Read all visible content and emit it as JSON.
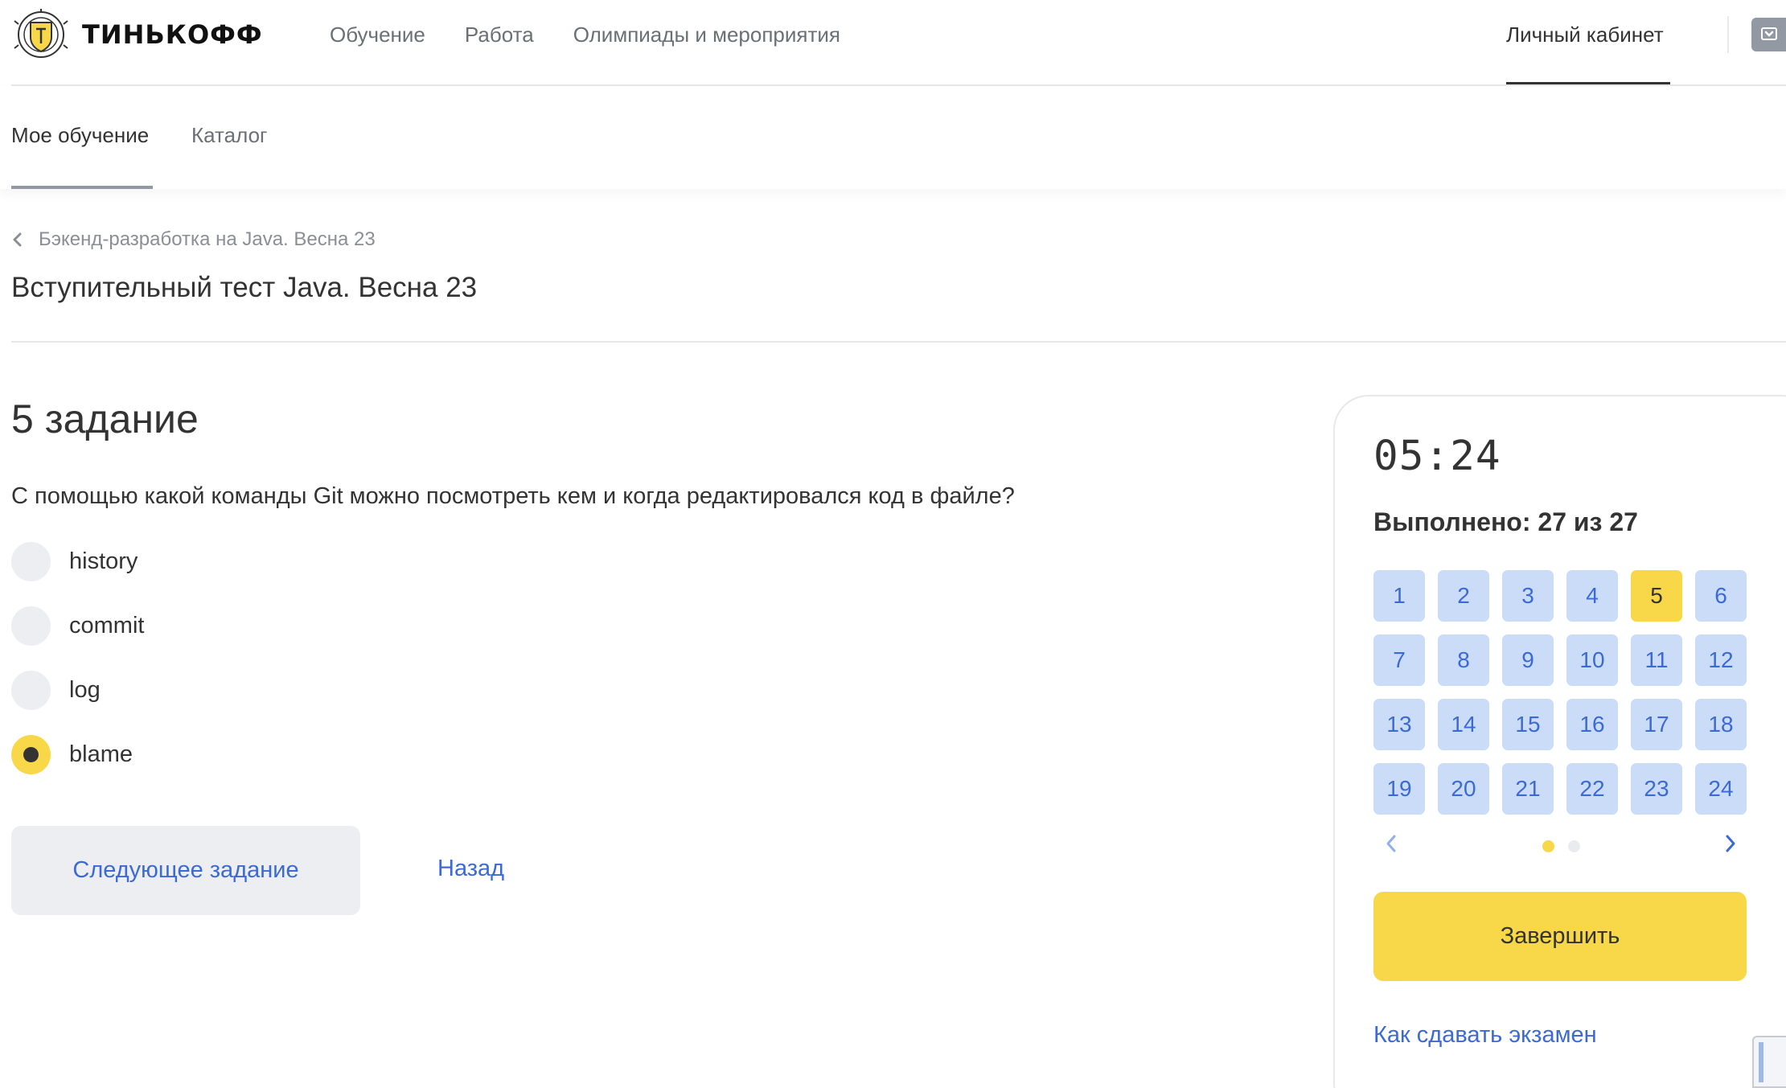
{
  "header": {
    "logo_text": "ТИНЬКОФФ",
    "nav": [
      "Обучение",
      "Работа",
      "Олимпиады и мероприятия"
    ],
    "account_label": "Личный кабинет"
  },
  "subnav": {
    "tabs": [
      "Мое обучение",
      "Каталог"
    ],
    "active_tab": "Мое обучение"
  },
  "breadcrumb": "Бэкенд-разработка на Java. Весна 23",
  "page_title": "Вступительный тест Java. Весна 23",
  "task": {
    "heading": "5 задание",
    "question": "С помощью какой команды Git можно посмотреть кем и когда редактировался код в файле?",
    "options": [
      "history",
      "commit",
      "log",
      "blame"
    ],
    "selected": "blame",
    "next_label": "Следующее задание",
    "back_label": "Назад"
  },
  "panel": {
    "timer": "05:24",
    "progress_label": "Выполнено: 27 из 27",
    "task_numbers": [
      "1",
      "2",
      "3",
      "4",
      "5",
      "6",
      "7",
      "8",
      "9",
      "10",
      "11",
      "12",
      "13",
      "14",
      "15",
      "16",
      "17",
      "18",
      "19",
      "20",
      "21",
      "22",
      "23",
      "24"
    ],
    "current_task": "5",
    "page_count": 2,
    "current_page": 1,
    "finish_label": "Завершить",
    "help_link": "Как сдавать экзамен"
  },
  "colors": {
    "accent_yellow": "#f8d849",
    "link_blue": "#3c6ad4",
    "cell_blue": "#cbdcf8",
    "neutral_bg": "#eceef1"
  }
}
